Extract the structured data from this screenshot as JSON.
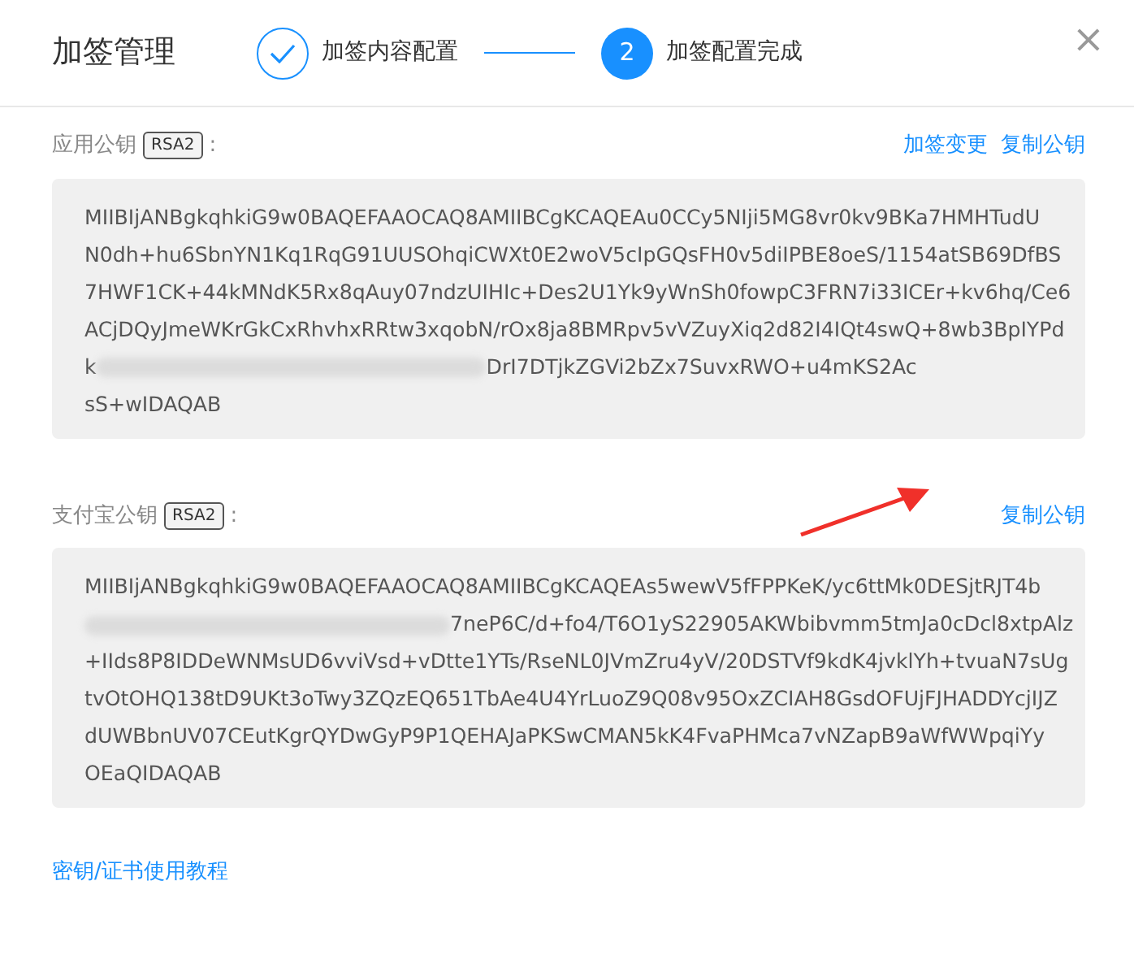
{
  "title": "加签管理",
  "steps": [
    {
      "label": "加签内容配置",
      "done": true
    },
    {
      "number": "2",
      "label": "加签配置完成",
      "done": false
    }
  ],
  "close": "×",
  "sections": [
    {
      "label": "应用公钥",
      "badge": "RSA2",
      "colon": ":",
      "actions": [
        "加签变更",
        "复制公钥"
      ],
      "highlighted_action": false,
      "key_lines": [
        {
          "kind": "plain",
          "text": "MIIBIjANBgkqhkiG9w0BAQEFAAOCAQ8AMIIBCgKCAQEAu0CCy5NIji5MG8vr0kv9BKa7HMHTudU"
        },
        {
          "kind": "plain",
          "text": "N0dh+hu6SbnYN1Kq1RqG91UUSOhqiCWXt0E2woV5cIpGQsFH0v5diIPBE8oeS/1154atSB69DfBS"
        },
        {
          "kind": "plain",
          "text": "7HWF1CK+44kMNdK5Rx8qAuy07ndzUIHIc+Des2U1Yk9yWnSh0fowpC3FRN7i33ICEr+kv6hq/Ce6"
        },
        {
          "kind": "plain",
          "text": "ACjDQyJmeWKrGkCxRhvhxRRtw3xqobN/rOx8ja8BMRpv5vVZuyXiq2d82I4IQt4swQ+8wb3BpIYPd"
        },
        {
          "kind": "redacted",
          "before": "k",
          "after": "DrI7DTjkZGVi2bZx7SuvxRWO+u4mKS2Ac"
        },
        {
          "kind": "plain",
          "text": "sS+wIDAQAB"
        }
      ]
    },
    {
      "label": "支付宝公钥",
      "badge": "RSA2",
      "colon": ":",
      "actions": [
        "复制公钥"
      ],
      "highlighted_action": true,
      "key_lines": [
        {
          "kind": "plain",
          "text": "MIIBIjANBgkqhkiG9w0BAQEFAAOCAQ8AMIIBCgKCAQEAs5wewV5fFPPKeK/yc6ttMk0DESjtRJT4b"
        },
        {
          "kind": "redacted",
          "after": "7neP6C/d+fo4/T6O1yS22905AKWbibvmm5tmJa0cDcl8xtpAlz"
        },
        {
          "kind": "plain",
          "text": "+IIds8P8IDDeWNMsUD6vviVsd+vDtte1YTs/RseNL0JVmZru4yV/20DSTVf9kdK4jvklYh+tvuaN7sUg"
        },
        {
          "kind": "plain",
          "text": "tvOtOHQ138tD9UKt3oTwy3ZQzEQ651TbAe4U4YrLuoZ9Q08v95OxZCIAH8GsdOFUjFJHADDYcjIJZ"
        },
        {
          "kind": "plain",
          "text": "dUWBbnUV07CEutKgrQYDwGyP9P1QEHAJaPKSwCMAN5kK4FvaPHMca7vNZapB9aWfWWpqiYy"
        },
        {
          "kind": "plain",
          "text": "OEaQIDAQAB"
        }
      ]
    }
  ],
  "tutorial_link": "密钥/证书使用教程"
}
